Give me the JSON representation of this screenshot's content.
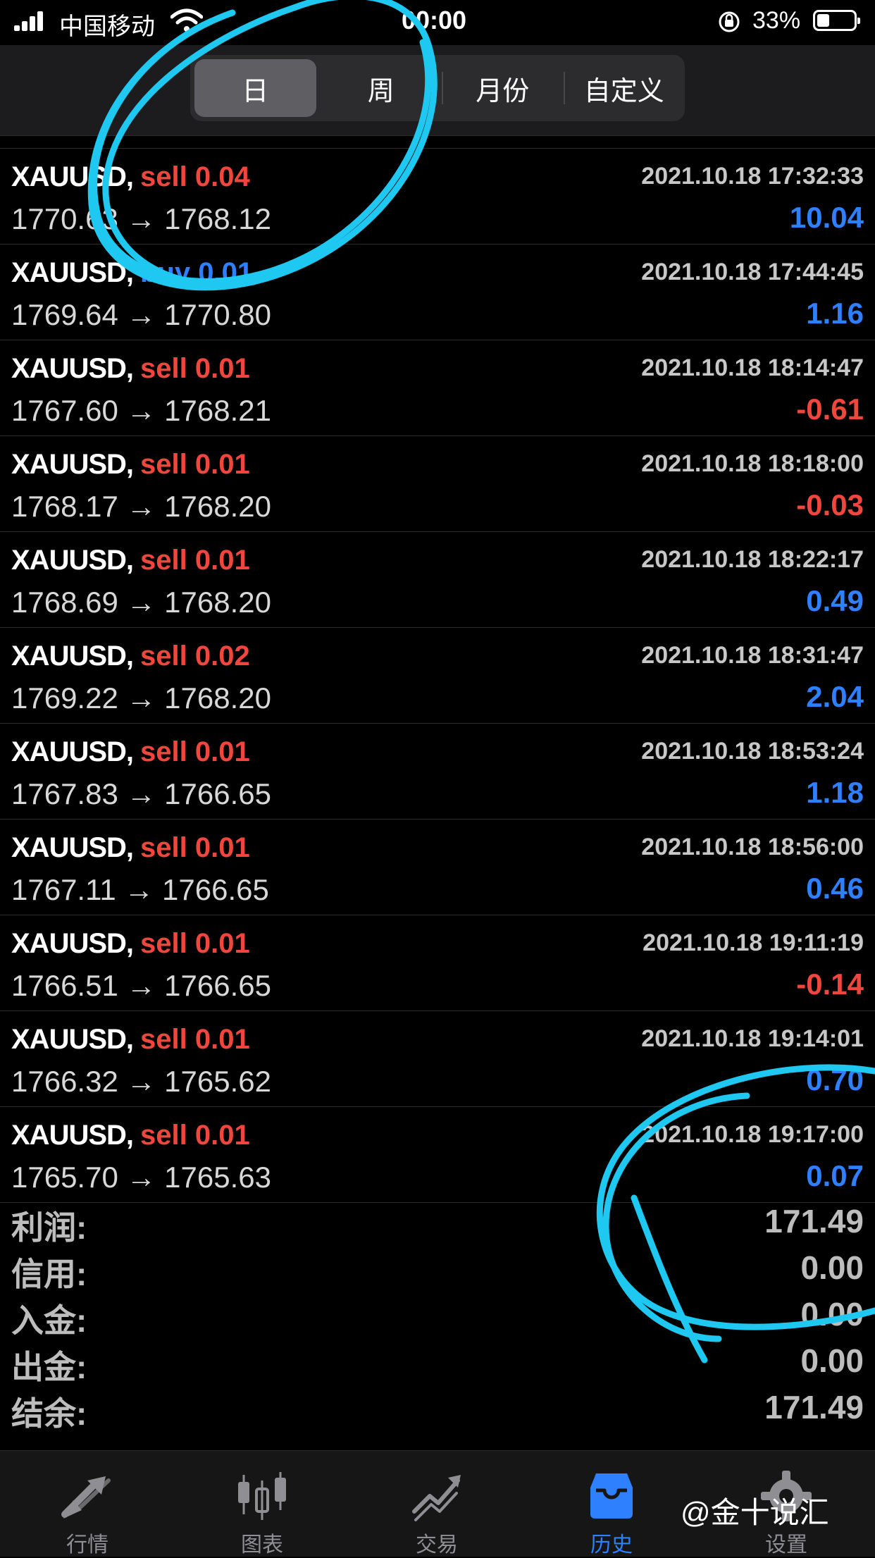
{
  "status_bar": {
    "carrier": "中国移动",
    "time": "00:00",
    "battery_percent": "33%",
    "battery_level": 0.33
  },
  "header": {
    "tabs": [
      {
        "label": "日",
        "active": true
      },
      {
        "label": "周",
        "active": false
      },
      {
        "label": "月份",
        "active": false
      },
      {
        "label": "自定义",
        "active": false
      }
    ]
  },
  "trades": [
    {
      "symbol": "XAUUSD,",
      "side": "sell 0.04",
      "type": "sell",
      "time": "2021.10.18 17:32:33",
      "prices": "1770.63 → 1768.12",
      "profit": "10.04",
      "sign": "pos"
    },
    {
      "symbol": "XAUUSD,",
      "side": "buy 0.01",
      "type": "buy",
      "time": "2021.10.18 17:44:45",
      "prices": "1769.64 → 1770.80",
      "profit": "1.16",
      "sign": "pos"
    },
    {
      "symbol": "XAUUSD,",
      "side": "sell 0.01",
      "type": "sell",
      "time": "2021.10.18 18:14:47",
      "prices": "1767.60 → 1768.21",
      "profit": "-0.61",
      "sign": "neg"
    },
    {
      "symbol": "XAUUSD,",
      "side": "sell 0.01",
      "type": "sell",
      "time": "2021.10.18 18:18:00",
      "prices": "1768.17 → 1768.20",
      "profit": "-0.03",
      "sign": "neg"
    },
    {
      "symbol": "XAUUSD,",
      "side": "sell 0.01",
      "type": "sell",
      "time": "2021.10.18 18:22:17",
      "prices": "1768.69 → 1768.20",
      "profit": "0.49",
      "sign": "pos"
    },
    {
      "symbol": "XAUUSD,",
      "side": "sell 0.02",
      "type": "sell",
      "time": "2021.10.18 18:31:47",
      "prices": "1769.22 → 1768.20",
      "profit": "2.04",
      "sign": "pos"
    },
    {
      "symbol": "XAUUSD,",
      "side": "sell 0.01",
      "type": "sell",
      "time": "2021.10.18 18:53:24",
      "prices": "1767.83 → 1766.65",
      "profit": "1.18",
      "sign": "pos"
    },
    {
      "symbol": "XAUUSD,",
      "side": "sell 0.01",
      "type": "sell",
      "time": "2021.10.18 18:56:00",
      "prices": "1767.11 → 1766.65",
      "profit": "0.46",
      "sign": "pos"
    },
    {
      "symbol": "XAUUSD,",
      "side": "sell 0.01",
      "type": "sell",
      "time": "2021.10.18 19:11:19",
      "prices": "1766.51 → 1766.65",
      "profit": "-0.14",
      "sign": "neg"
    },
    {
      "symbol": "XAUUSD,",
      "side": "sell 0.01",
      "type": "sell",
      "time": "2021.10.18 19:14:01",
      "prices": "1766.32 → 1765.62",
      "profit": "0.70",
      "sign": "pos"
    },
    {
      "symbol": "XAUUSD,",
      "side": "sell 0.01",
      "type": "sell",
      "time": "2021.10.18 19:17:00",
      "prices": "1765.70 → 1765.63",
      "profit": "0.07",
      "sign": "pos"
    }
  ],
  "summary": [
    {
      "label": "利润:",
      "value": "171.49"
    },
    {
      "label": "信用:",
      "value": "0.00"
    },
    {
      "label": "入金:",
      "value": "0.00"
    },
    {
      "label": "出金:",
      "value": "0.00"
    },
    {
      "label": "结余:",
      "value": "171.49"
    }
  ],
  "tabbar": {
    "items": [
      {
        "label": "行情",
        "icon": "quotes-arrows-icon",
        "active": false
      },
      {
        "label": "图表",
        "icon": "candlestick-chart-icon",
        "active": false
      },
      {
        "label": "交易",
        "icon": "trade-trend-icon",
        "active": false
      },
      {
        "label": "历史",
        "icon": "history-inbox-icon",
        "active": true
      },
      {
        "label": "设置",
        "icon": "gear-icon",
        "active": false
      }
    ]
  },
  "watermark": "@金十说汇",
  "colors": {
    "sell": "#f0463c",
    "buy": "#2f80ff",
    "annotation": "#1ec8f0"
  }
}
